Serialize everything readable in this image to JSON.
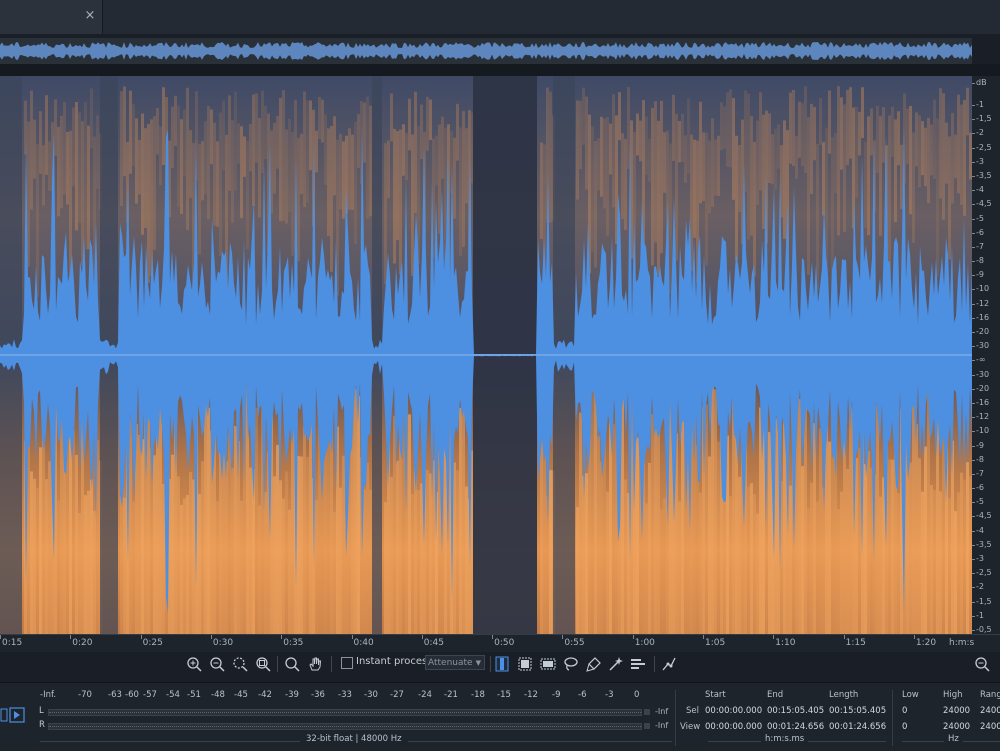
{
  "tab": {
    "close_glyph": "×"
  },
  "db_scale": {
    "unit": "dB",
    "ticks": [
      "-1",
      "-1,5",
      "-2",
      "-2,5",
      "-3",
      "-3,5",
      "-4",
      "-4,5",
      "-5",
      "-6",
      "-7",
      "-8",
      "-9",
      "-10",
      "-12",
      "-16",
      "-20",
      "-30",
      "-∞",
      "-30",
      "-20",
      "-16",
      "-12",
      "-10",
      "-9",
      "-8",
      "-7",
      "-6",
      "-5",
      "-4,5",
      "-4",
      "-3,5",
      "-3",
      "-2,5",
      "-2",
      "-1,5",
      "-1",
      "-0,5"
    ]
  },
  "time_ruler": {
    "labels": [
      "0:15",
      "0:20",
      "0:25",
      "0:30",
      "0:35",
      "0:40",
      "0:45",
      "0:50",
      "0:55",
      "1:00",
      "1:05",
      "1:10",
      "1:15",
      "1:20"
    ],
    "unit": "h:m:s"
  },
  "toolbar": {
    "instant_process_label": "Instant process",
    "mode_value": "Attenuate",
    "icons": [
      "zoom-in-icon",
      "zoom-out-icon",
      "zoom-selection-icon",
      "zoom-full-icon",
      "magnifier-icon",
      "hand-icon",
      "time-selection-icon",
      "frequency-selection-icon",
      "time-frequency-selection-icon",
      "lasso-icon",
      "brush-icon",
      "magic-wand-icon",
      "harmonic-selection-icon",
      "envelope-icon"
    ]
  },
  "meter": {
    "scale": [
      "-Inf.",
      "-70",
      "-63",
      "-60",
      "-57",
      "-54",
      "-51",
      "-48",
      "-45",
      "-42",
      "-39",
      "-36",
      "-33",
      "-30",
      "-27",
      "-24",
      "-21",
      "-18",
      "-15",
      "-12",
      "-9",
      "-6",
      "-3",
      "0"
    ],
    "channels": [
      {
        "name": "L",
        "peak": "-Inf"
      },
      {
        "name": "R",
        "peak": "-Inf"
      }
    ],
    "format": "32-bit float | 48000 Hz"
  },
  "selection": {
    "headers": {
      "start": "Start",
      "end": "End",
      "length": "Length"
    },
    "sel": {
      "label": "Sel",
      "start": "00:00:00.000",
      "end": "00:15:05.405",
      "length": "00:15:05.405"
    },
    "view": {
      "label": "View",
      "start": "00:00:00.000",
      "end": "00:01:24.656",
      "length": "00:01:24.656"
    },
    "unit": "h:m:s.ms"
  },
  "frequency": {
    "headers": {
      "low": "Low",
      "high": "High",
      "range": "Rang"
    },
    "sel": {
      "low": "0",
      "high": "24000",
      "range": "2400"
    },
    "view": {
      "low": "0",
      "high": "24000",
      "range": "2400"
    },
    "unit": "Hz"
  },
  "colors": {
    "waveform": "#4d8fe0",
    "spectrogram_hot": "#f0a464",
    "background": "#1a1f27"
  }
}
